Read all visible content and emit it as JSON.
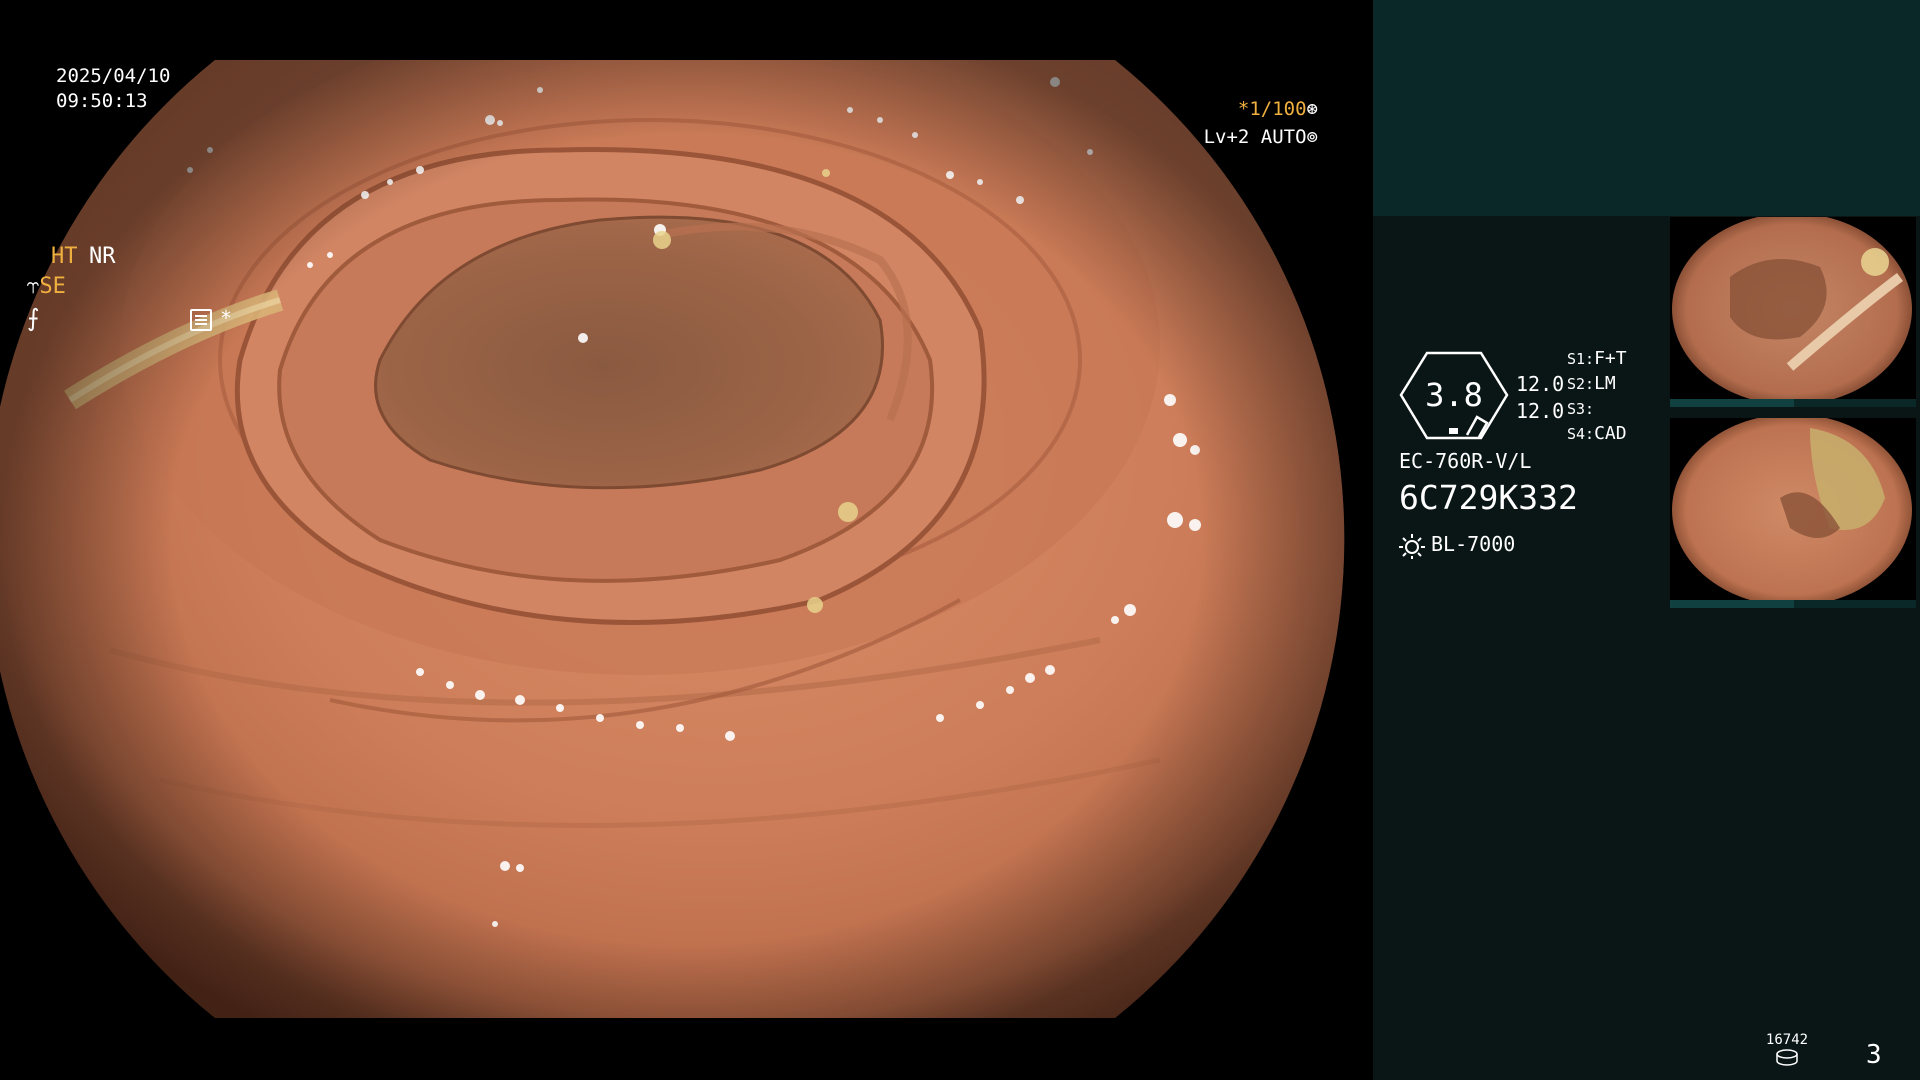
{
  "overlay": {
    "date": "2025/04/10",
    "time": "09:50:13",
    "shutter": "*1/100",
    "shutter_icon": "aperture-icon",
    "iris": "Lv+2 AUTO",
    "iris_icon": "iris-icon"
  },
  "panel": {
    "ht_label": "HT",
    "nr_label": "NR",
    "se_label": "SE",
    "enhance_icon": "enhance-icon",
    "memo_icon": "memo-icon",
    "star": "*",
    "zoom_value": "3.8",
    "zoom_setting_1": "12.0",
    "zoom_setting_2": "12.0",
    "switches": [
      {
        "key": "S1:",
        "value": "F+T"
      },
      {
        "key": "S2:",
        "value": "LM"
      },
      {
        "key": "S3:",
        "value": ""
      },
      {
        "key": "S4:",
        "value": "CAD"
      }
    ],
    "scope_model": "EC-760R-V/L",
    "scope_serial": "6C729K332",
    "light_source": "BL-7000",
    "light_icon": "light-source-icon",
    "image_counter": "16742",
    "storage_icon": "storage-disk-icon",
    "page_number": "3"
  },
  "thumbnails": [
    {
      "id": "6C729K332"
    },
    {
      "id": "6C729K332"
    }
  ],
  "colors": {
    "osd_accent": "#f0b040",
    "panel_bg": "#0a1616",
    "panel_header": "#0b2828",
    "mucosa": "#c97a58"
  }
}
